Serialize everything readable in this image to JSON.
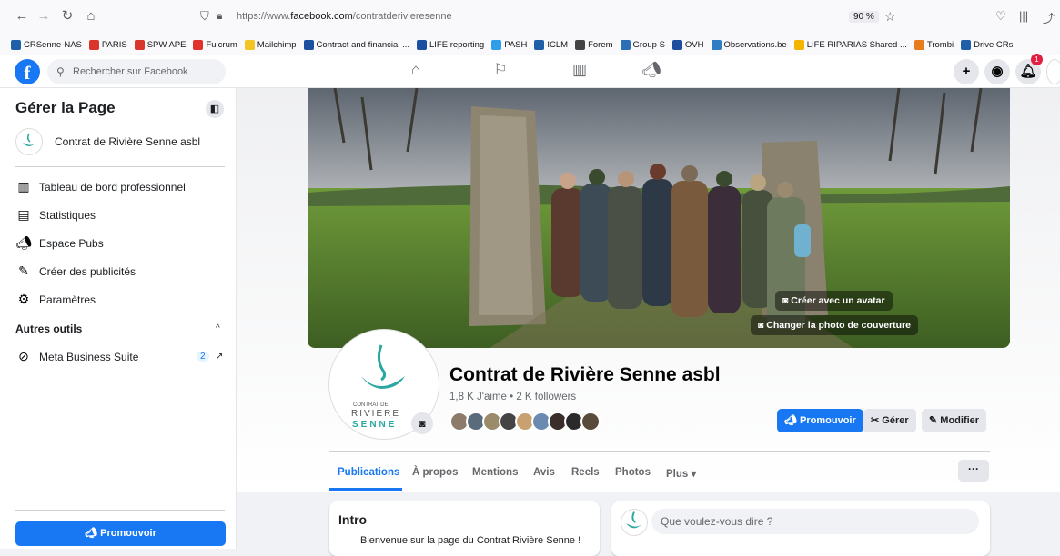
{
  "browser": {
    "url_prefix": "https://www.",
    "url_domain": "facebook.com",
    "url_path": "/contratderivieresenne",
    "zoom": "90 %",
    "bookmarks": [
      {
        "label": "CRSenne-NAS",
        "color": "#1f5fa8"
      },
      {
        "label": "PARIS",
        "color": "#d9352b"
      },
      {
        "label": "SPW APE",
        "color": "#d9352b"
      },
      {
        "label": "Fulcrum",
        "color": "#e0312b"
      },
      {
        "label": "Mailchimp",
        "color": "#f2c522"
      },
      {
        "label": "Contract and financial ...",
        "color": "#1b4fa0"
      },
      {
        "label": "LIFE reporting",
        "color": "#1b4fa0"
      },
      {
        "label": "PASH",
        "color": "#2f9de8"
      },
      {
        "label": "ICLM",
        "color": "#1f5fa8"
      },
      {
        "label": "Forem",
        "color": "#444444"
      },
      {
        "label": "Group S",
        "color": "#2b6fb5"
      },
      {
        "label": "OVH",
        "color": "#1d4f9e"
      },
      {
        "label": "Observations.be",
        "color": "#2f7dc2"
      },
      {
        "label": "LIFE RIPARIAS Shared ...",
        "color": "#f4b400"
      },
      {
        "label": "Trombi",
        "color": "#e87b1b"
      },
      {
        "label": "Drive CRs",
        "color": "#1f5fa8"
      }
    ]
  },
  "fb": {
    "logo": "f",
    "search_placeholder": "Rechercher sur Facebook",
    "notification_count": "1"
  },
  "sidebar": {
    "title": "Gérer la Page",
    "page_name": "Contrat de Rivière Senne asbl",
    "items": [
      {
        "label": "Tableau de bord professionnel",
        "icon": "dashboard-icon"
      },
      {
        "label": "Statistiques",
        "icon": "stats-icon"
      },
      {
        "label": "Espace Pubs",
        "icon": "megaphone-icon"
      },
      {
        "label": "Créer des publicités",
        "icon": "edit-icon"
      },
      {
        "label": "Paramètres",
        "icon": "gear-icon"
      }
    ],
    "other_tools": "Autres outils",
    "meta_suite": "Meta Business Suite",
    "meta_count": "2",
    "promote": "Promouvoir"
  },
  "cover": {
    "avatar_btn": "Créer avec un avatar",
    "change_btn": "Changer la photo de couverture"
  },
  "logo_text": {
    "line1": "CONTRAT DE",
    "line2": "RIVIERE",
    "line3": "SENNE"
  },
  "page": {
    "title": "Contrat de Rivière Senne asbl",
    "stats": "1,8 K J'aime • 2 K followers",
    "promote": "Promouvoir",
    "manage": "Gérer",
    "edit": "Modifier"
  },
  "tabs": [
    "Publications",
    "À propos",
    "Mentions",
    "Avis",
    "Reels",
    "Photos",
    "Plus ▾"
  ],
  "intro": {
    "title": "Intro",
    "text": "Bienvenue sur la page du Contrat Rivière Senne !"
  },
  "composer": {
    "placeholder": "Que voulez-vous dire ?"
  }
}
